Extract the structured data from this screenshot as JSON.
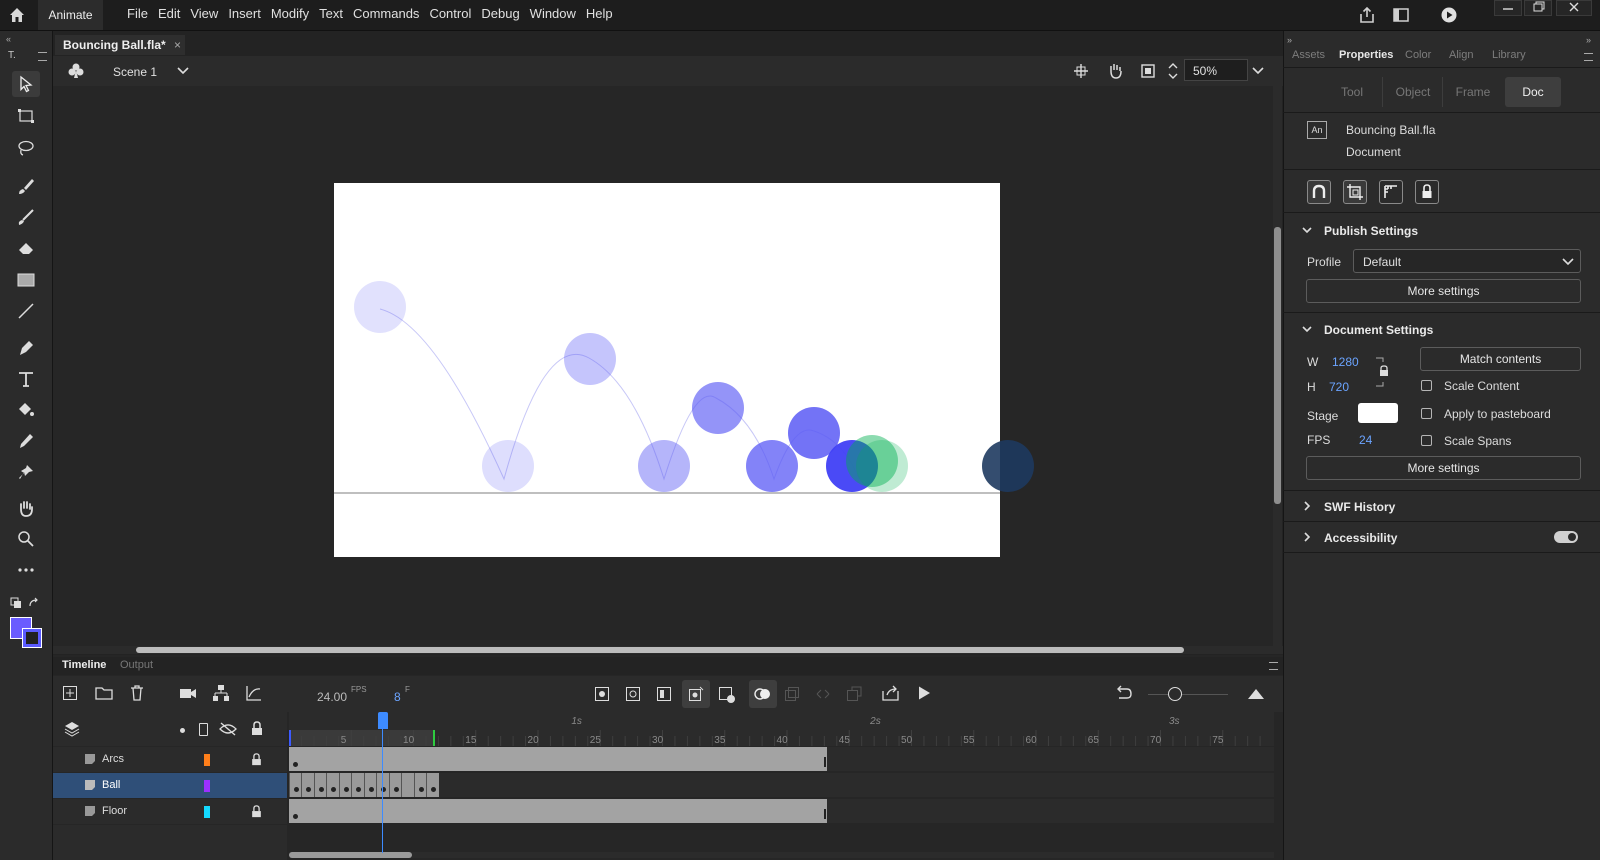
{
  "menubar": {
    "app_name": "Animate",
    "menus": [
      "File",
      "Edit",
      "View",
      "Insert",
      "Modify",
      "Text",
      "Commands",
      "Control",
      "Debug",
      "Window",
      "Help"
    ]
  },
  "tools": {
    "left_label": "T.",
    "items": [
      "selection-tool",
      "free-transform-tool",
      "lasso-tool",
      "paint-brush-tool",
      "brush-tool",
      "eraser-tool",
      "rectangle-tool",
      "line-tool",
      "pen-tool",
      "text-tool",
      "paint-bucket-tool",
      "eyedropper-tool",
      "pin-tool",
      "hand-tool",
      "zoom-tool",
      "more-tools"
    ],
    "stroke_color": "#6a5cff",
    "fill_color": "#5b5bff"
  },
  "document": {
    "tab_title": "Bouncing Ball.fla*",
    "scene": "Scene 1",
    "zoom": "50%"
  },
  "stage": {
    "background": "#ffffff",
    "ball_color": "#5a5af5",
    "ghost_color": "#00b050"
  },
  "timeline": {
    "tabs": [
      "Timeline",
      "Output"
    ],
    "fps_value": "24.00",
    "fps_unit": "FPS",
    "current_frame": "8",
    "frame_unit": "F",
    "seconds_markers": [
      "1s",
      "2s",
      "3s"
    ],
    "frame_numbers": [
      "5",
      "10",
      "15",
      "20",
      "25",
      "30",
      "35",
      "40",
      "45",
      "50",
      "55",
      "60",
      "65",
      "70",
      "75"
    ],
    "layers": [
      {
        "name": "Arcs",
        "color": "#ff7f1a",
        "locked": true,
        "selected": false
      },
      {
        "name": "Ball",
        "color": "#9b30ff",
        "locked": false,
        "selected": true
      },
      {
        "name": "Floor",
        "color": "#14d9ff",
        "locked": true,
        "selected": false
      }
    ]
  },
  "properties": {
    "panel_tabs": [
      "Assets",
      "Properties",
      "Color",
      "Align",
      "Library"
    ],
    "sub_tabs": [
      "Tool",
      "Object",
      "Frame",
      "Doc"
    ],
    "doc_name": "Bouncing Ball.fla",
    "doc_type": "Document",
    "doc_badge": "An",
    "publish_settings": "Publish Settings",
    "profile_label": "Profile",
    "profile_value": "Default",
    "more_settings": "More settings",
    "document_settings": "Document Settings",
    "w_label": "W",
    "w_value": "1280",
    "h_label": "H",
    "h_value": "720",
    "match_contents": "Match contents",
    "scale_content": "Scale Content",
    "stage_label": "Stage",
    "apply_pasteboard": "Apply to pasteboard",
    "fps_label": "FPS",
    "fps_value": "24",
    "scale_spans": "Scale Spans",
    "swf_history": "SWF History",
    "accessibility": "Accessibility"
  }
}
